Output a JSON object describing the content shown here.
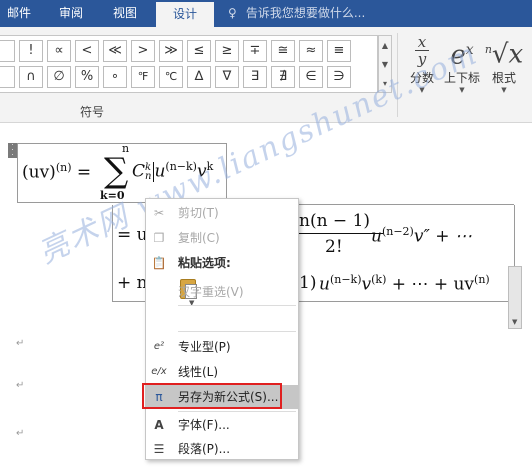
{
  "ribbon": {
    "tabs": [
      {
        "label": "邮件",
        "active": false
      },
      {
        "label": "审阅",
        "active": false
      },
      {
        "label": "视图",
        "active": false
      },
      {
        "label": "设计",
        "active": true
      }
    ],
    "tell_me": "告诉我您想要做什么...",
    "symbols_row1": [
      "!",
      "∝",
      "<",
      "≪",
      ">",
      "≫",
      "≤",
      "≥",
      "∓",
      "≅",
      "≈",
      "≡"
    ],
    "symbols_row2": [
      "∩",
      "∅",
      "%",
      "∘",
      "℉",
      "℃",
      "∆",
      "∇",
      "∃",
      "∄",
      "∈",
      "∋"
    ],
    "symbols_group_label": "符号",
    "structure_buttons": [
      {
        "label": "分数",
        "icon": "fraction-icon"
      },
      {
        "label": "上下标",
        "icon": "script-icon"
      },
      {
        "label": "根式",
        "icon": "radical-icon"
      }
    ]
  },
  "equation": {
    "line1_lhs": "(uv)",
    "line1_lhs_sup": "(n)",
    "sum_upper": "n",
    "sum_lower": "k=0",
    "coef": "C",
    "coef_sup": "k",
    "coef_sub": "n",
    "u_term": "u",
    "u_sup": "(n−k)",
    "v_term": "v",
    "v_sup": "k",
    "line2_prefix": "= u",
    "line2_frac_num": "n(n − 1)",
    "line2_frac_den": "2!",
    "line2_tail": "u",
    "line2_tail_sup": "(n−2)",
    "line2_tail_v": "v″ + ⋯",
    "line3_prefix": "+ n",
    "line3_frac_num_tail": "1)",
    "line3_tail": "u",
    "line3_tail_sup": "(n−k)",
    "line3_tail_v": "v",
    "line3_tail_v_sup": "(k)",
    "line3_end": "+ ⋯ + uv",
    "line3_end_sup": "(n)"
  },
  "watermark": "亮术网 www.liangshunet.com",
  "context_menu": {
    "cut": "剪切(T)",
    "copy": "复制(C)",
    "paste_options": "粘贴选项:",
    "reconvert": "汉字重选(V)",
    "professional": "专业型(P)",
    "linear": "线性(L)",
    "save_as_new": "另存为新公式(S)...",
    "font": "字体(F)...",
    "paragraph": "段落(P)..."
  },
  "colors": {
    "ribbon_blue": "#2b579a",
    "highlight_red": "#e02020",
    "menu_hover": "#c6c6c6"
  }
}
